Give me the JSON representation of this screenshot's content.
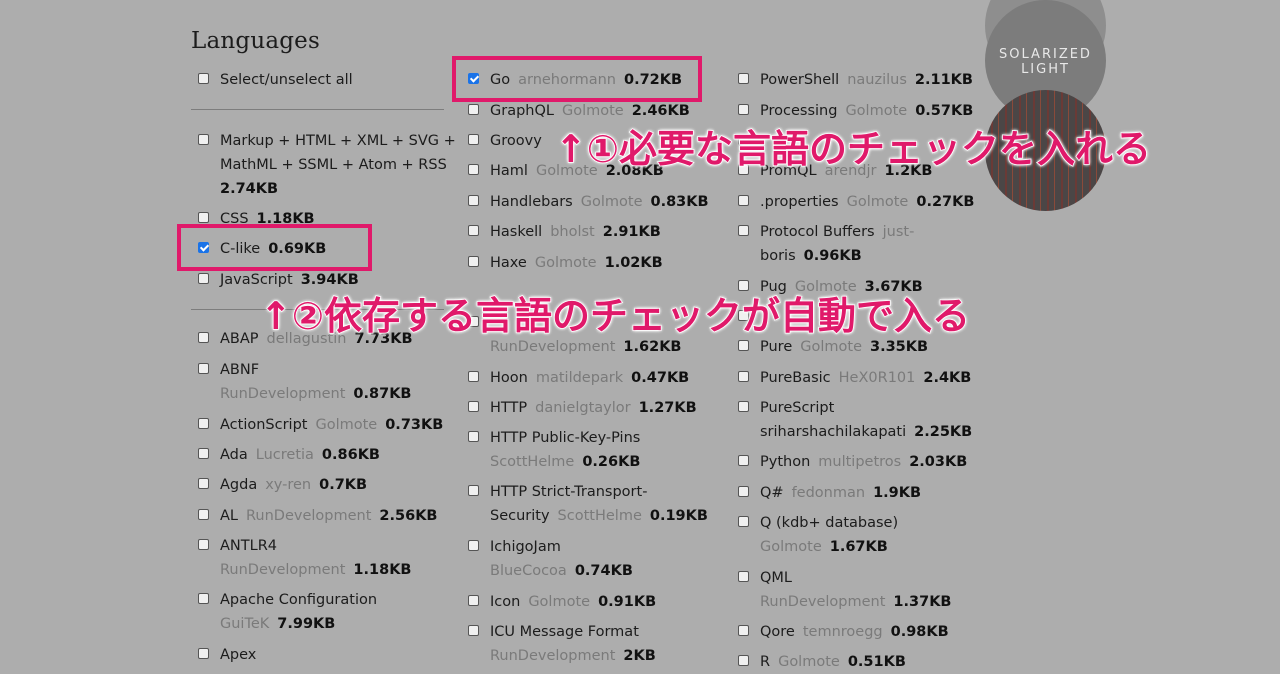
{
  "heading": "Languages",
  "theme": {
    "label_line1": "SOLARIZED",
    "label_line2": "LIGHT"
  },
  "annotations": {
    "step1": "↑①必要な言語のチェックを入れる",
    "step2": "↑②依存する言語のチェックが自動で入る"
  },
  "columns": {
    "col1": [
      {
        "lines": [
          [
            "Select/unselect all"
          ]
        ],
        "checked": false
      },
      {
        "lines": [
          [
            "Markup + HTML + XML + SVG +"
          ],
          [
            "MathML + SSML + Atom + RSS"
          ],
          [
            "",
            "",
            "2.74KB"
          ]
        ],
        "checked": false
      },
      {
        "lines": [
          [
            "CSS",
            "",
            "1.18KB"
          ]
        ],
        "checked": false
      },
      {
        "lines": [
          [
            "C-like",
            "",
            "0.69KB"
          ]
        ],
        "checked": true
      },
      {
        "lines": [
          [
            "JavaScript",
            "",
            "3.94KB"
          ]
        ],
        "checked": false
      },
      {
        "lines": [
          [
            "ABAP",
            "dellagustin",
            "7.73KB"
          ]
        ],
        "checked": false
      },
      {
        "lines": [
          [
            "ABNF"
          ],
          [
            "",
            "RunDevelopment",
            "0.87KB"
          ]
        ],
        "checked": false
      },
      {
        "lines": [
          [
            "ActionScript",
            "Golmote",
            "0.73KB"
          ]
        ],
        "checked": false
      },
      {
        "lines": [
          [
            "Ada",
            "Lucretia",
            "0.86KB"
          ]
        ],
        "checked": false
      },
      {
        "lines": [
          [
            "Agda",
            "xy-ren",
            "0.7KB"
          ]
        ],
        "checked": false
      },
      {
        "lines": [
          [
            "AL",
            "RunDevelopment",
            "2.56KB"
          ]
        ],
        "checked": false
      },
      {
        "lines": [
          [
            "ANTLR4"
          ],
          [
            "",
            "RunDevelopment",
            "1.18KB"
          ]
        ],
        "checked": false
      },
      {
        "lines": [
          [
            "Apache Configuration"
          ],
          [
            "",
            "GuiTeK",
            "7.99KB"
          ]
        ],
        "checked": false
      },
      {
        "lines": [
          [
            "Apex"
          ]
        ],
        "checked": false
      }
    ],
    "col2": [
      {
        "lines": [
          [
            "Go",
            "arnehormann",
            "0.72KB"
          ]
        ],
        "checked": true
      },
      {
        "lines": [
          [
            "GraphQL",
            "Golmote",
            "2.46KB"
          ]
        ],
        "checked": false
      },
      {
        "lines": [
          [
            "Groovy",
            "",
            ""
          ]
        ],
        "checked": false
      },
      {
        "lines": [
          [
            "Haml",
            "Golmote",
            "2.08KB"
          ]
        ],
        "checked": false
      },
      {
        "lines": [
          [
            "Handlebars",
            "Golmote",
            "0.83KB"
          ]
        ],
        "checked": false
      },
      {
        "lines": [
          [
            "Haskell",
            "bholst",
            "2.91KB"
          ]
        ],
        "checked": false
      },
      {
        "lines": [
          [
            "Haxe",
            "Golmote",
            "1.02KB"
          ]
        ],
        "checked": false
      },
      {
        "lines": [
          [
            "",
            "",
            ""
          ],
          [
            "",
            "RunDevelopment",
            "1.62KB"
          ]
        ],
        "checked": false
      },
      {
        "lines": [
          [
            "Hoon",
            "matildepark",
            "0.47KB"
          ]
        ],
        "checked": false
      },
      {
        "lines": [
          [
            "HTTP",
            "danielgtaylor",
            "1.27KB"
          ]
        ],
        "checked": false
      },
      {
        "lines": [
          [
            "HTTP Public-Key-Pins"
          ],
          [
            "",
            "ScottHelme",
            "0.26KB"
          ]
        ],
        "checked": false
      },
      {
        "lines": [
          [
            "HTTP Strict-Transport-"
          ],
          [
            "Security",
            "ScottHelme",
            "0.19KB"
          ]
        ],
        "checked": false
      },
      {
        "lines": [
          [
            "IchigoJam"
          ],
          [
            "",
            "BlueCocoa",
            "0.74KB"
          ]
        ],
        "checked": false
      },
      {
        "lines": [
          [
            "Icon",
            "Golmote",
            "0.91KB"
          ]
        ],
        "checked": false
      },
      {
        "lines": [
          [
            "ICU Message Format"
          ],
          [
            "",
            "RunDevelopment",
            "2KB"
          ]
        ],
        "checked": false
      }
    ],
    "col3": [
      {
        "lines": [
          [
            "PowerShell",
            "nauzilus",
            "2.11KB"
          ]
        ],
        "checked": false
      },
      {
        "lines": [
          [
            "Processing",
            "Golmote",
            "0.57KB"
          ]
        ],
        "checked": false
      },
      {
        "lines": [
          [
            "",
            "",
            ""
          ]
        ],
        "checked": false
      },
      {
        "lines": [
          [
            "PromQL",
            "arendjr",
            "1.2KB"
          ]
        ],
        "checked": false
      },
      {
        "lines": [
          [
            ".properties",
            "Golmote",
            "0.27KB"
          ]
        ],
        "checked": false
      },
      {
        "lines": [
          [
            "Protocol Buffers",
            "just-"
          ],
          [
            "boris",
            "",
            "0.96KB"
          ]
        ],
        "checked": false
      },
      {
        "lines": [
          [
            "Pug",
            "Golmote",
            "3.67KB"
          ]
        ],
        "checked": false
      },
      {
        "lines": [
          [
            "",
            "",
            ""
          ]
        ],
        "checked": false
      },
      {
        "lines": [
          [
            "Pure",
            "Golmote",
            "3.35KB"
          ]
        ],
        "checked": false
      },
      {
        "lines": [
          [
            "PureBasic",
            "HeX0R101",
            "2.4KB"
          ]
        ],
        "checked": false
      },
      {
        "lines": [
          [
            "PureScript"
          ],
          [
            "sriharshachilakapati",
            "",
            "2.25KB"
          ]
        ],
        "checked": false
      },
      {
        "lines": [
          [
            "Python",
            "multipetros",
            "2.03KB"
          ]
        ],
        "checked": false
      },
      {
        "lines": [
          [
            "Q#",
            "fedonman",
            "1.9KB"
          ]
        ],
        "checked": false
      },
      {
        "lines": [
          [
            "Q (kdb+ database)"
          ],
          [
            "",
            "Golmote",
            "1.67KB"
          ]
        ],
        "checked": false
      },
      {
        "lines": [
          [
            "QML"
          ],
          [
            "",
            "RunDevelopment",
            "1.37KB"
          ]
        ],
        "checked": false
      },
      {
        "lines": [
          [
            "Qore",
            "temnroegg",
            "0.98KB"
          ]
        ],
        "checked": false
      },
      {
        "lines": [
          [
            "R",
            "Golmote",
            "0.51KB"
          ]
        ],
        "checked": false
      }
    ]
  }
}
